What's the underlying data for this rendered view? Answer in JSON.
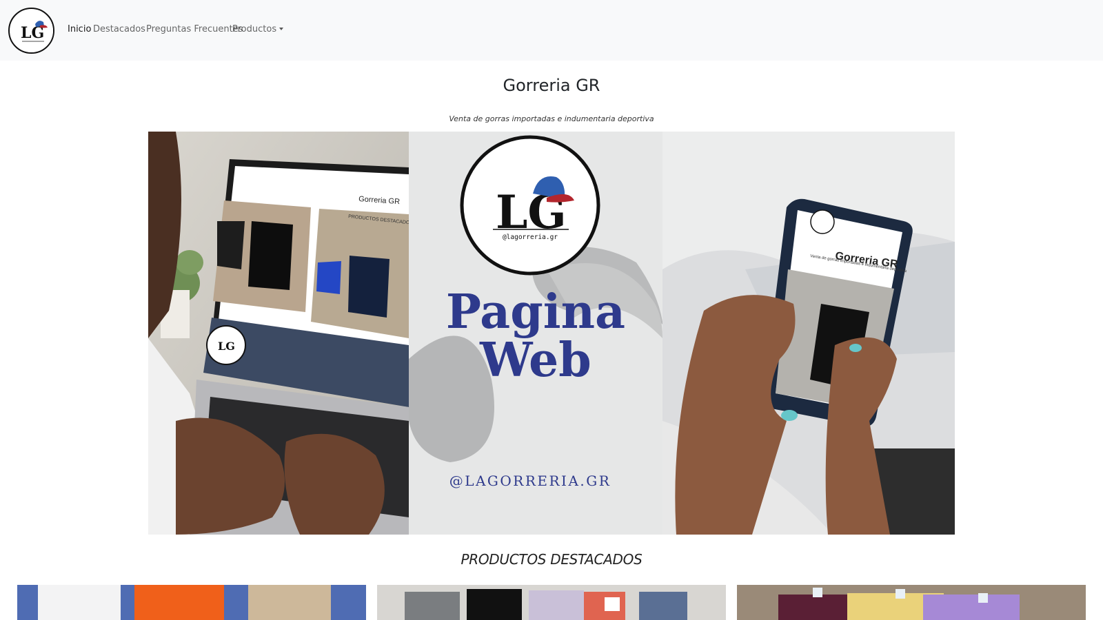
{
  "navbar": {
    "logo_text": "LG",
    "items": [
      {
        "label": "Inicio"
      },
      {
        "label": "Destacados"
      },
      {
        "label": "Preguntas Frecuentes"
      },
      {
        "label": "Productos"
      }
    ]
  },
  "header": {
    "title": "Gorreria GR",
    "subtitle": "Venta de gorras importadas e indumentaria deportiva"
  },
  "banner": {
    "logo_letters": "LG",
    "logo_handle": "@lagorreria.gr",
    "headline_line1": "Pagina",
    "headline_line2": "Web",
    "handle": "@LAGORRERIA.GR",
    "laptop_screen_title": "Gorreria GR",
    "laptop_screen_section": "PRODUCTOS DESTACADOS",
    "phone_screen_title": "Gorreria GR",
    "phone_screen_subtitle": "Venta de gorras importadas e indumentaria deportiva"
  },
  "featured": {
    "title": "PRODUCTOS DESTACADOS",
    "cards": [
      {
        "name": "product-card-shorts"
      },
      {
        "name": "product-card-tshirts"
      },
      {
        "name": "product-card-tees-color"
      }
    ]
  },
  "colors": {
    "navbar_bg": "#f8f9fa",
    "brand_navy": "#2e3a8c",
    "cap_blue": "#2f5fb0",
    "cap_red": "#b3262d"
  }
}
